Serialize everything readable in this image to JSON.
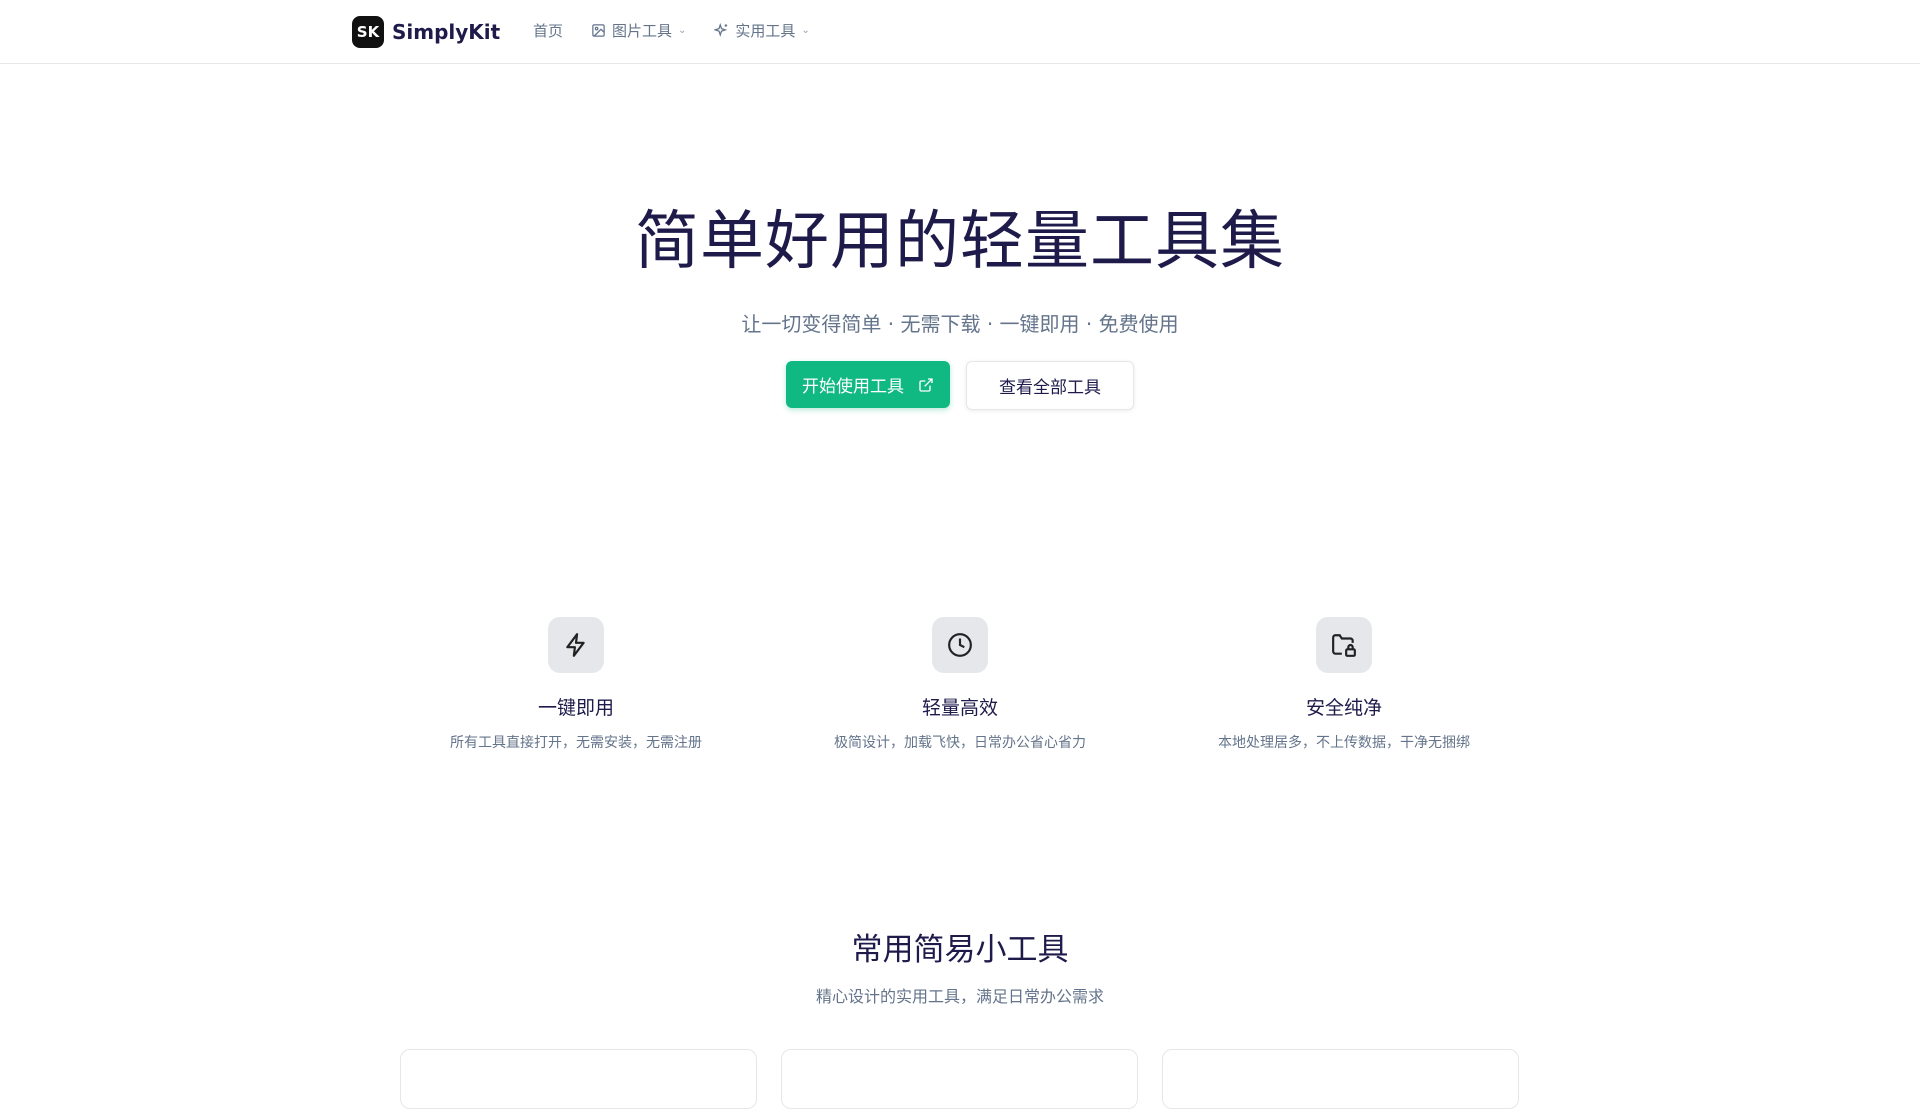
{
  "header": {
    "logo_badge": "SK",
    "logo_text": "SimplyKit",
    "nav": [
      {
        "label": "首页"
      },
      {
        "label": "图片工具"
      },
      {
        "label": "实用工具"
      }
    ]
  },
  "hero": {
    "title": "简单好用的轻量工具集",
    "subtitle": "让一切变得简单 · 无需下载 · 一键即用 · 免费使用",
    "primary_button": "开始使用工具",
    "secondary_button": "查看全部工具"
  },
  "features": [
    {
      "icon": "lightning-icon",
      "title": "一键即用",
      "desc": "所有工具直接打开，无需安装，无需注册"
    },
    {
      "icon": "clock-icon",
      "title": "轻量高效",
      "desc": "极简设计，加载飞快，日常办公省心省力"
    },
    {
      "icon": "folder-lock-icon",
      "title": "安全纯净",
      "desc": "本地处理居多，不上传数据，干净无捆绑"
    }
  ],
  "tools_section": {
    "title": "常用简易小工具",
    "subtitle": "精心设计的实用工具，满足日常办公需求"
  },
  "colors": {
    "accent": "#10b981",
    "text": "#1e1b4b",
    "muted": "#64748b"
  }
}
